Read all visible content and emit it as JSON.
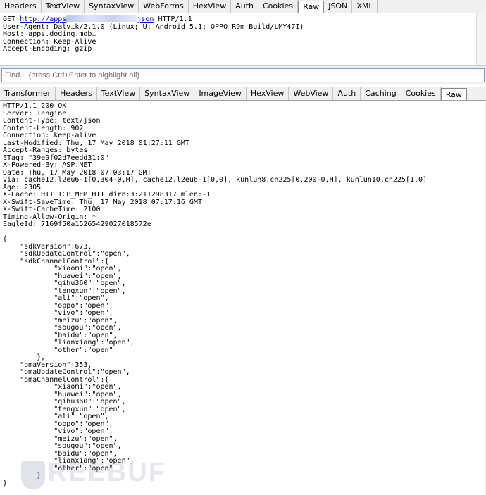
{
  "request_tabs": [
    "Headers",
    "TextView",
    "SyntaxView",
    "WebForms",
    "HexView",
    "Auth",
    "Cookies",
    "Raw",
    "JSON",
    "XML"
  ],
  "request_active_tab": "Raw",
  "request": {
    "method": "GET ",
    "url_prefix": "http://apps",
    "url_suffix": "json",
    "protocol": " HTTP/1.1",
    "headers": "User-Agent: Dalvik/2.1.0 (Linux; U; Android 5.1; OPPO R9m Build/LMY47I)\nHost: apps.doding.mobi\nConnection: Keep-Alive\nAccept-Encoding: gzip"
  },
  "find": {
    "placeholder": "Find... (press Ctrl+Enter to highlight all)"
  },
  "response_tabs": [
    "Transformer",
    "Headers",
    "TextView",
    "SyntaxView",
    "ImageView",
    "HexView",
    "WebView",
    "Auth",
    "Caching",
    "Cookies",
    "Raw"
  ],
  "response_active_tab": "Raw",
  "response": {
    "headers": "HTTP/1.1 200 OK\nServer: Tengine\nContent-Type: text/json\nContent-Length: 902\nConnection: keep-alive\nLast-Modified: Thu, 17 May 2018 01:27:11 GMT\nAccept-Ranges: bytes\nETag: \"39e9f02d7eedd31:0\"\nX-Powered-By: ASP.NET\nDate: Thu, 17 May 2018 07:03:17 GMT\nVia: cache12.l2eu6-1[0,304-0,H], cache12.l2eu6-1[0,0], kunlun8.cn225[0,200-0,H], kunlun10.cn225[1,0]\nAge: 2305\nX-Cache: HIT TCP_MEM_HIT dirn:3:211298317 mlen:-1\nX-Swift-SaveTime: Thu, 17 May 2018 07:17:16 GMT\nX-Swift-CacheTime: 2100\nTiming-Allow-Origin: *\nEagleId: 7169f50a15265429027018572e",
    "body": "{\n    \"sdkVersion\":673,\n    \"sdkUpdateControl\":\"open\",\n    \"sdkChannelControl\":{\n            \"xiaomi\":\"open\",\n            \"huawei\":\"open\",\n            \"qihu360\":\"open\",\n            \"tengxun\":\"open\",\n            \"ali\":\"open\",\n            \"oppo\":\"open\",\n            \"vivo\":\"open\",\n            \"meizu\":\"open\",\n            \"sougou\":\"open\",\n            \"baidu\":\"open\",\n            \"lianxiang\":\"open\",\n            \"other\":\"open\"\n        },\n    \"omaVersion\":353,\n    \"omaUpdateControl\":\"open\",\n    \"omaChannelControl\":{\n            \"xiaomi\":\"open\",\n            \"huawei\":\"open\",\n            \"qihu360\":\"open\",\n            \"tengxun\":\"open\",\n            \"ali\":\"open\",\n            \"oppo\":\"open\",\n            \"vivo\":\"open\",\n            \"meizu\":\"open\",\n            \"sougou\":\"open\",\n            \"baidu\":\"open\",\n            \"lianxiang\":\"open\",\n            \"other\":\"open\"\n        }\n}"
  },
  "watermark": "FREEBUF"
}
